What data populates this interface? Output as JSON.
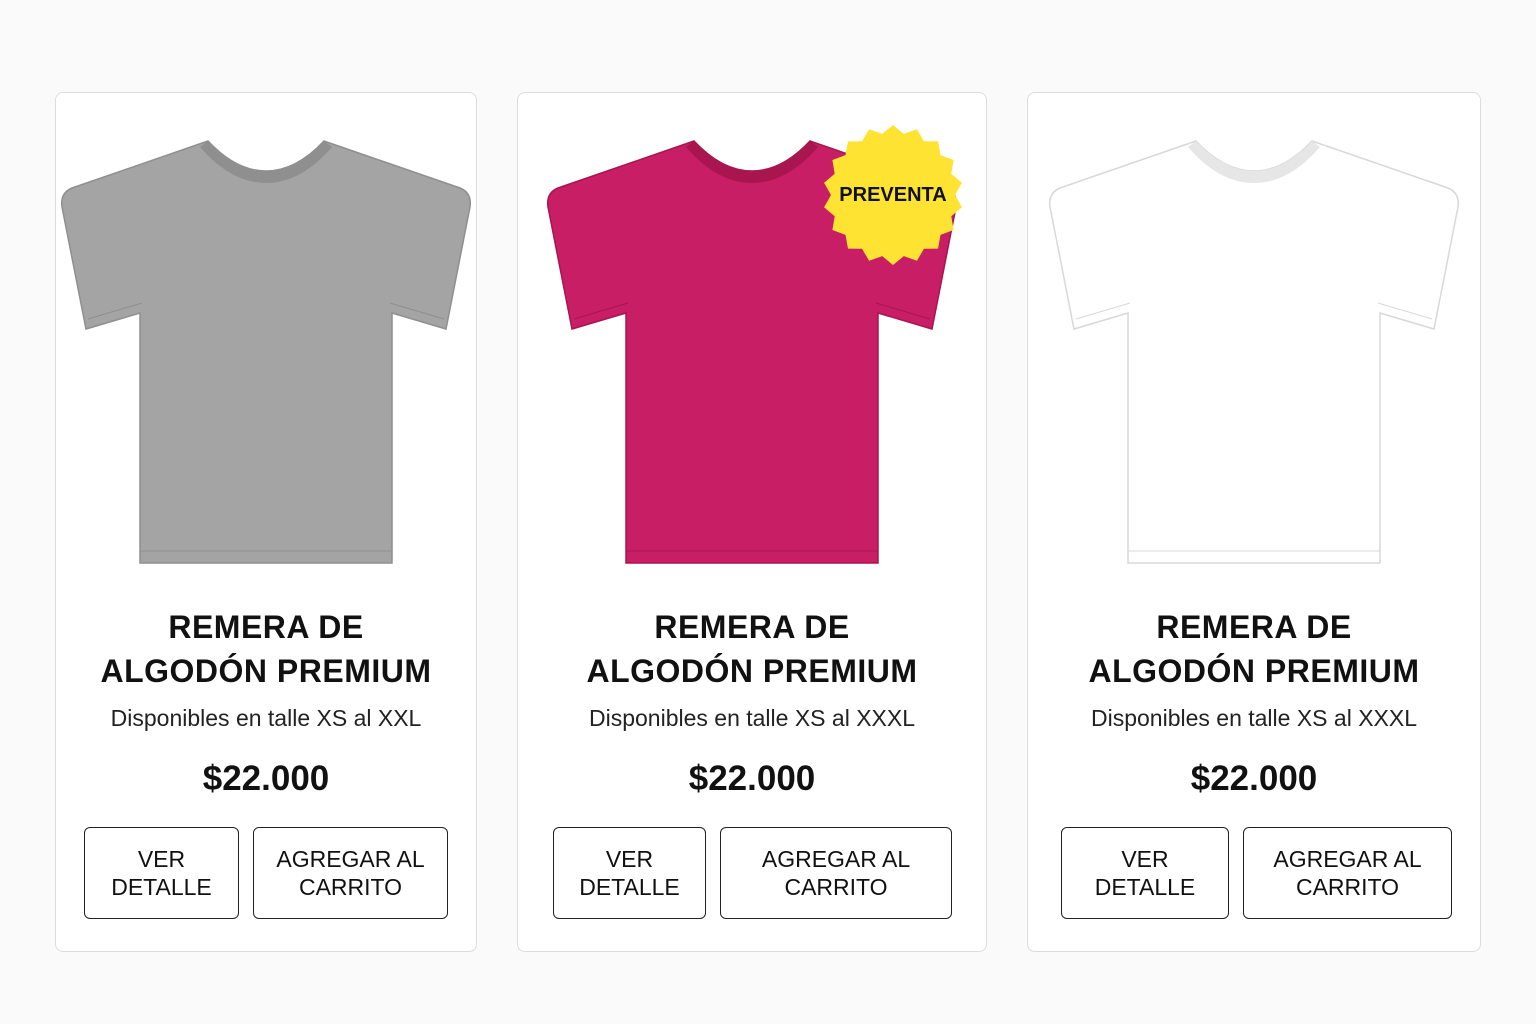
{
  "products": [
    {
      "color_name": "gray",
      "shirt_color": "#a4a4a4",
      "shirt_shade": "#8f8f8f",
      "title_line1": "REMERA DE",
      "title_line2": "ALGODÓN PREMIUM",
      "sizes": "Disponibles en talle XS al XXL",
      "price": "$22.000",
      "detail_label": "VER DETALLE",
      "cart_label": "AGREGAR AL CARRITO",
      "badge": ""
    },
    {
      "color_name": "magenta",
      "shirt_color": "#c81e66",
      "shirt_shade": "#a8154f",
      "title_line1": "REMERA DE",
      "title_line2": "ALGODÓN PREMIUM",
      "sizes": "Disponibles en talle XS al XXXL",
      "price": "$22.000",
      "detail_label": "VER DETALLE",
      "cart_label": "AGREGAR AL CARRITO",
      "badge": "PREVENTA"
    },
    {
      "color_name": "white",
      "shirt_color": "#ffffff",
      "shirt_shade": "#e6e6e6",
      "title_line1": "REMERA DE",
      "title_line2": "ALGODÓN PREMIUM",
      "sizes": "Disponibles en talle XS al XXXL",
      "price": "$22.000",
      "detail_label": "VER DETALLE",
      "cart_label": "AGREGAR AL CARRITO",
      "badge": ""
    }
  ],
  "colors": {
    "badge_bg": "#ffe332",
    "button_border": "#222222",
    "card_border": "#dddddd"
  }
}
